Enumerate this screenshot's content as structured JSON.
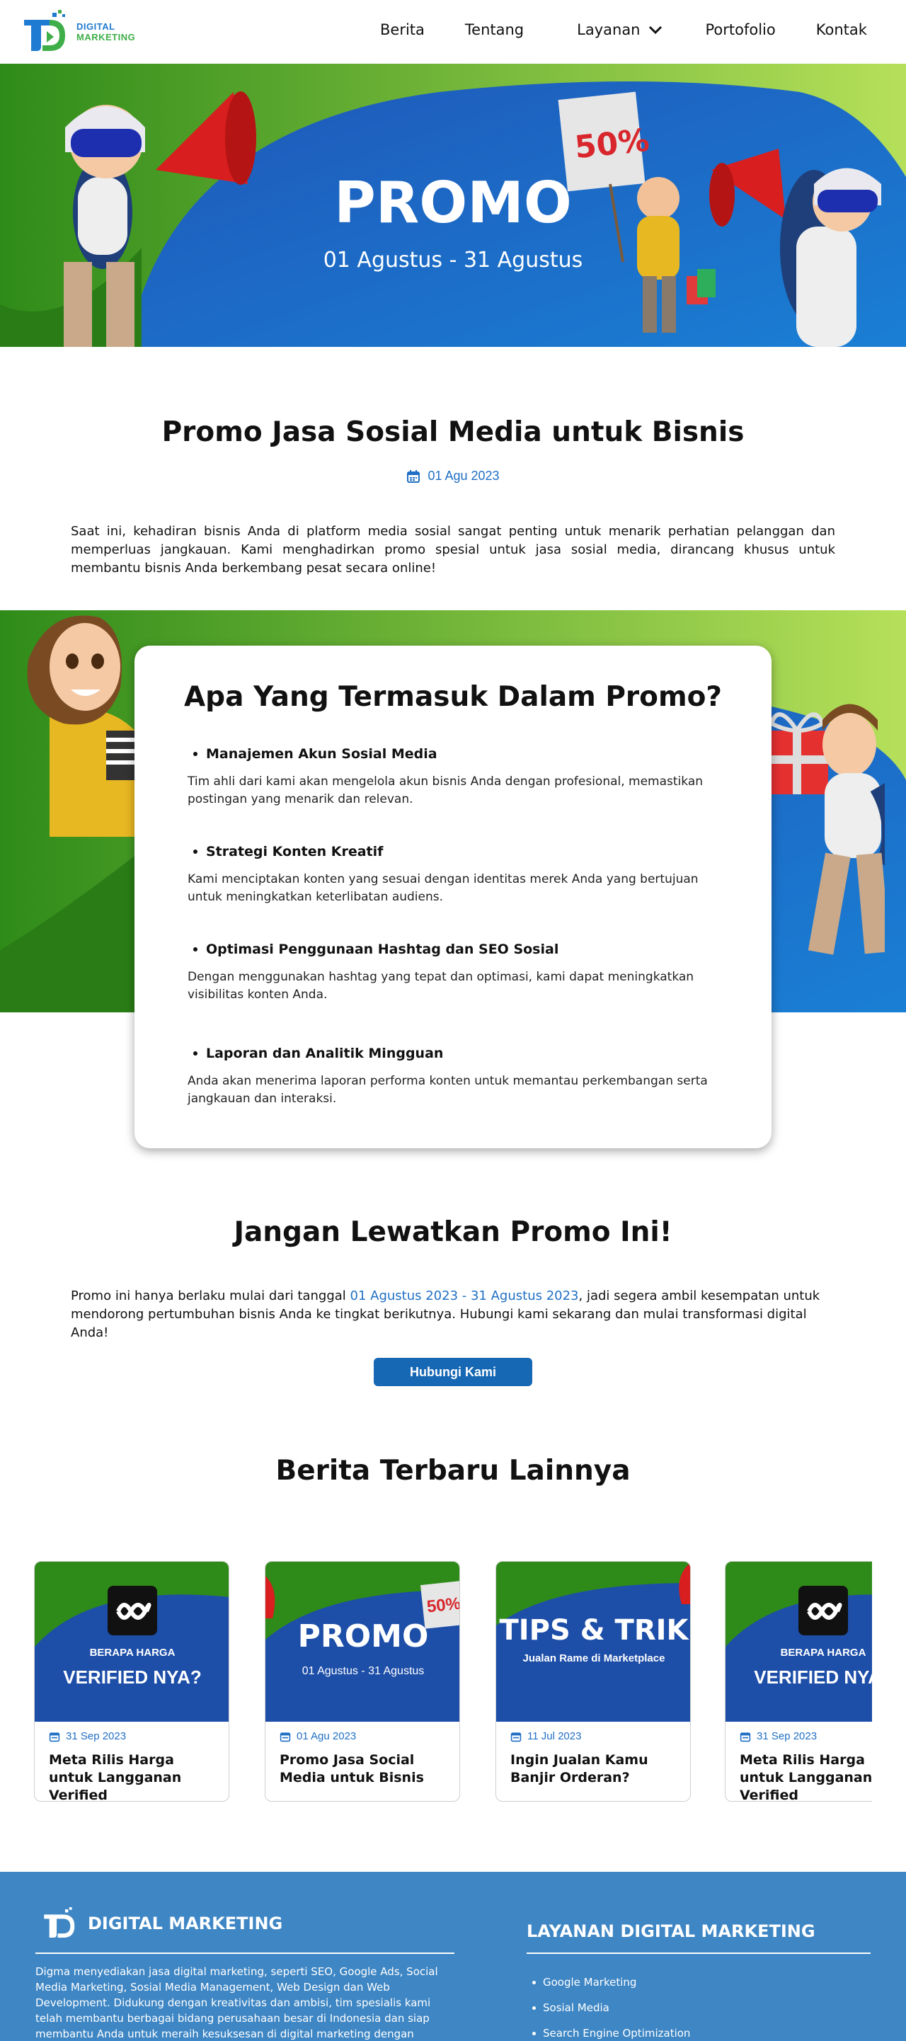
{
  "nav": {
    "logo_line1": "DIGITAL",
    "logo_line2": "MARKETING",
    "items": [
      "Berita",
      "Tentang",
      "Layanan",
      "Portofolio",
      "Kontak"
    ]
  },
  "hero": {
    "title": "PROMO",
    "subtitle": "01 Agustus - 31 Agustus",
    "sign_text": "50%"
  },
  "article": {
    "title": "Promo Jasa Sosial Media untuk Bisnis",
    "date": "01 Agu 2023",
    "intro": "Saat ini, kehadiran bisnis Anda di platform media sosial sangat penting untuk menarik perhatian pelanggan dan memperluas jangkauan. Kami menghadirkan promo spesial untuk jasa sosial media, dirancang khusus untuk membantu bisnis Anda berkembang pesat secara online!"
  },
  "promo_card": {
    "title": "Apa Yang Termasuk Dalam Promo?",
    "features": [
      {
        "heading": "Manajemen Akun Sosial Media",
        "text": "Tim ahli dari kami akan mengelola akun bisnis Anda dengan profesional, memastikan postingan yang menarik dan relevan."
      },
      {
        "heading": "Strategi Konten Kreatif",
        "text": "Kami menciptakan konten yang sesuai dengan identitas merek Anda yang bertujuan untuk meningkatkan keterlibatan audiens."
      },
      {
        "heading": "Optimasi Penggunaan Hashtag dan SEO Sosial",
        "text": "Dengan menggunakan hashtag yang tepat dan optimasi, kami dapat meningkatkan visibilitas konten Anda."
      },
      {
        "heading": "Laporan dan Analitik Mingguan",
        "text": "Anda akan menerima laporan performa konten untuk memantau perkembangan serta jangkauan dan interaksi."
      }
    ]
  },
  "cta": {
    "title": "Jangan Lewatkan Promo Ini!",
    "text_before": "Promo ini hanya berlaku mulai dari tanggal ",
    "text_highlight": "01 Agustus 2023 - 31 Agustus 2023",
    "text_after": ", jadi segera ambil kesempatan untuk mendorong pertumbuhan bisnis Anda ke tingkat berikutnya. Hubungi kami sekarang dan mulai transformasi digital Anda!",
    "button": "Hubungi Kami"
  },
  "news": {
    "title": "Berita Terbaru Lainnya",
    "cards": [
      {
        "date": "31 Sep 2023",
        "title": "Meta Rilis Harga  untuk Langganan Verified",
        "img_small": "BERAPA HARGA",
        "img_big": "VERIFIED NYA?"
      },
      {
        "date": "01 Agu 2023",
        "title": "Promo Jasa Social Media untuk Bisnis",
        "img_big": "PROMO",
        "img_small": "01 Agustus - 31 Agustus",
        "sign": "50%"
      },
      {
        "date": "11 Jul 2023",
        "title": "Ingin Jualan Kamu Banjir Orderan?",
        "img_big": "TIPS & TRIK",
        "img_small": "Jualan Rame di Marketplace"
      },
      {
        "date": "31 Sep 2023",
        "title": "Meta Rilis Harga  untuk Langganan Verified",
        "img_small": "BERAPA HARGA",
        "img_big": "VERIFIED NYA?"
      }
    ]
  },
  "footer": {
    "brand": "DIGITAL MARKETING",
    "description": "Digma menyediakan jasa digital marketing, seperti SEO, Google Ads, Social Media Marketing, Sosial Media Management, Web Design dan Web Development. Didukung dengan kreativitas dan ambisi, tim spesialis kami telah membantu berbagai bidang perusahaan besar di Indonesia dan siap membantu Anda untuk meraih kesuksesan di digital marketing dengan memberi strategi",
    "services_heading": "LAYANAN DIGITAL MARKETING",
    "services": [
      "Google Marketing",
      "Sosial Media",
      "Search Engine Optimization"
    ]
  },
  "colors": {
    "accent_blue": "#1f6fc4",
    "button_blue": "#1667b4",
    "footer_blue": "#3e86c4",
    "hero_green": "#2e8a1a",
    "hero_blue": "#1a5fbf"
  }
}
